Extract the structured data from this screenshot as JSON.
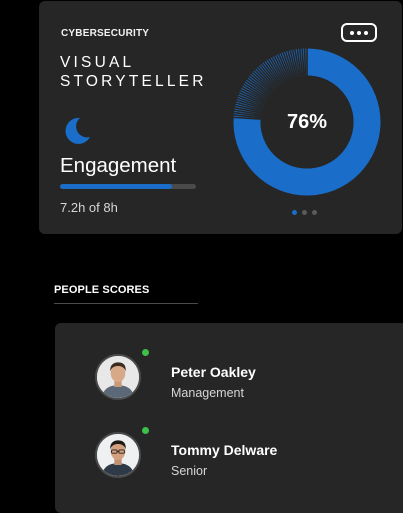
{
  "summary_card": {
    "category": "CYBERSECURITY",
    "title_line1": "VISUAL",
    "title_line2": "STORYTELLER",
    "icon": "moon-icon",
    "metric_label": "Engagement",
    "progress_fraction": 0.82,
    "progress_text": "7.2h of 8h",
    "donut_percent_text": "76%",
    "donut_fraction": 0.76,
    "pager": {
      "count": 3,
      "active_index": 0
    },
    "colors": {
      "accent": "#1a6ec9",
      "card": "#262626",
      "track": "#4a4a4a"
    }
  },
  "people_section": {
    "title": "PEOPLE SCORES",
    "people": [
      {
        "name": "Peter Oakley",
        "role": "Management",
        "online": true,
        "status_color": "#3dbf4a"
      },
      {
        "name": "Tommy Delware",
        "role": "Senior",
        "online": true,
        "status_color": "#3dbf4a"
      }
    ]
  }
}
